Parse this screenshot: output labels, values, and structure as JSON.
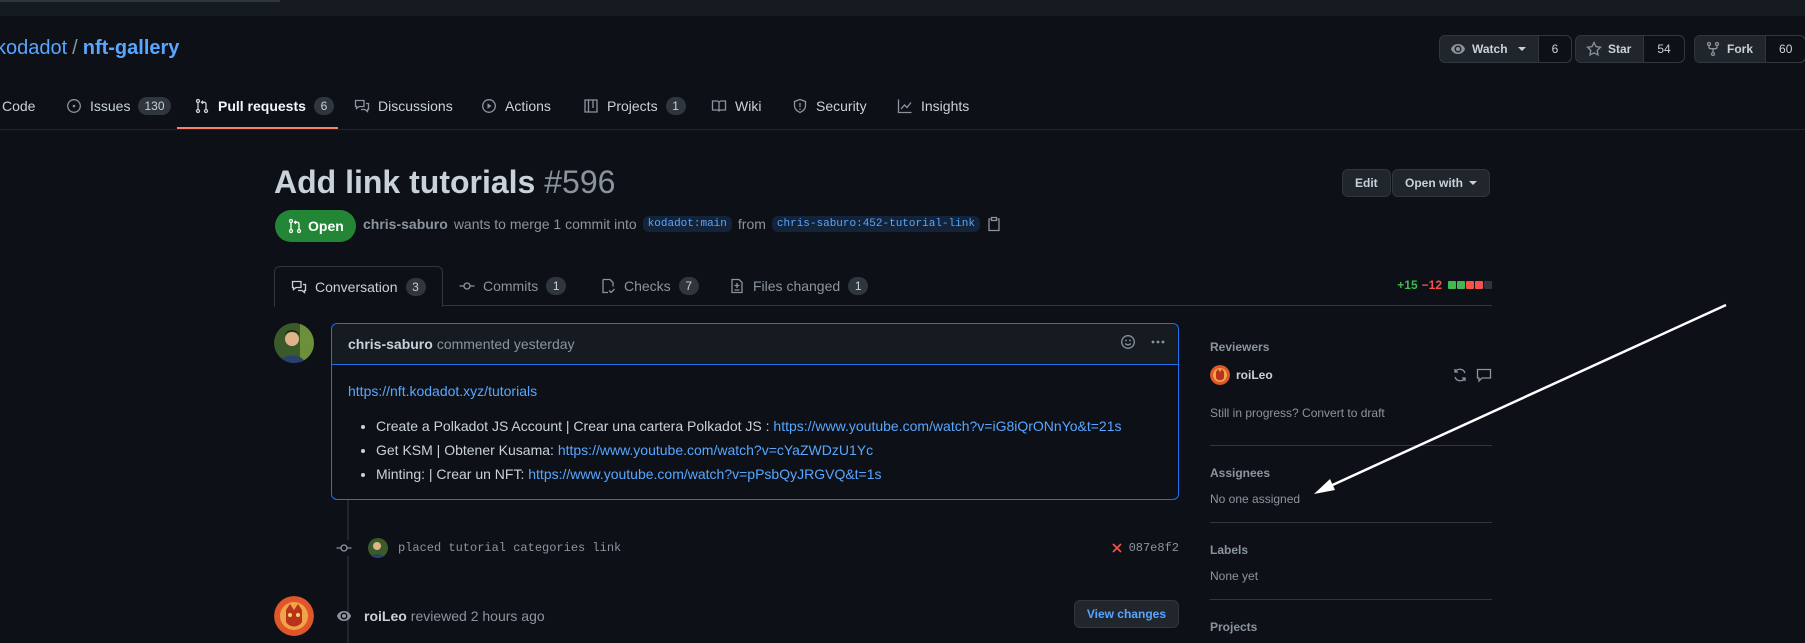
{
  "repo": {
    "owner": "kodadot",
    "separator": "/",
    "name": "nft-gallery"
  },
  "actions": {
    "watch": {
      "label": "Watch",
      "count": "6"
    },
    "star": {
      "label": "Star",
      "count": "54"
    },
    "fork": {
      "label": "Fork",
      "count": "60"
    }
  },
  "nav": {
    "code": "Code",
    "issues": {
      "label": "Issues",
      "count": "130"
    },
    "pulls": {
      "label": "Pull requests",
      "count": "6"
    },
    "discussions": "Discussions",
    "actions": "Actions",
    "projects": {
      "label": "Projects",
      "count": "1"
    },
    "wiki": "Wiki",
    "security": "Security",
    "insights": "Insights"
  },
  "pr": {
    "title": "Add link tutorials",
    "number": "#596",
    "edit": "Edit",
    "open_with": "Open with",
    "state": "Open",
    "author": "chris-saburo",
    "merge_text": "wants to merge 1 commit into",
    "base": "kodadot:main",
    "from_text": "from",
    "head": "chris-saburo:452-tutorial-link"
  },
  "tabs": {
    "conversation": {
      "label": "Conversation",
      "count": "3"
    },
    "commits": {
      "label": "Commits",
      "count": "1"
    },
    "checks": {
      "label": "Checks",
      "count": "7"
    },
    "files": {
      "label": "Files changed",
      "count": "1"
    }
  },
  "diffstat": {
    "additions": "+15",
    "deletions": "−12"
  },
  "comment": {
    "author": "chris-saburo",
    "action": "commented yesterday",
    "link": "https://nft.kodadot.xyz/tutorials",
    "items": [
      {
        "text": "Create a Polkadot JS Account | Crear una cartera Polkadot JS : ",
        "url": "https://www.youtube.com/watch?v=iG8iQrONnYo&t=21s"
      },
      {
        "text": "Get KSM | Obtener Kusama: ",
        "url": "https://www.youtube.com/watch?v=cYaZWDzU1Yc"
      },
      {
        "text": "Minting: | Crear un NFT: ",
        "url": "https://www.youtube.com/watch?v=pPsbQyJRGVQ&t=1s"
      }
    ]
  },
  "commit": {
    "message": "placed tutorial categories link",
    "sha": "087e8f2"
  },
  "review": {
    "author": "roiLeo",
    "action": "reviewed 2 hours ago",
    "button": "View changes"
  },
  "sidebar": {
    "reviewers": {
      "heading": "Reviewers",
      "name": "roiLeo",
      "draft": "Still in progress? Convert to draft"
    },
    "assignees": {
      "heading": "Assignees",
      "value": "No one assigned"
    },
    "labels": {
      "heading": "Labels",
      "value": "None yet"
    },
    "projects": {
      "heading": "Projects"
    }
  },
  "colors": {
    "accent": "#58a6ff",
    "open": "#238636",
    "underline": "#f78166",
    "add": "#3fb950",
    "del": "#f85149"
  }
}
